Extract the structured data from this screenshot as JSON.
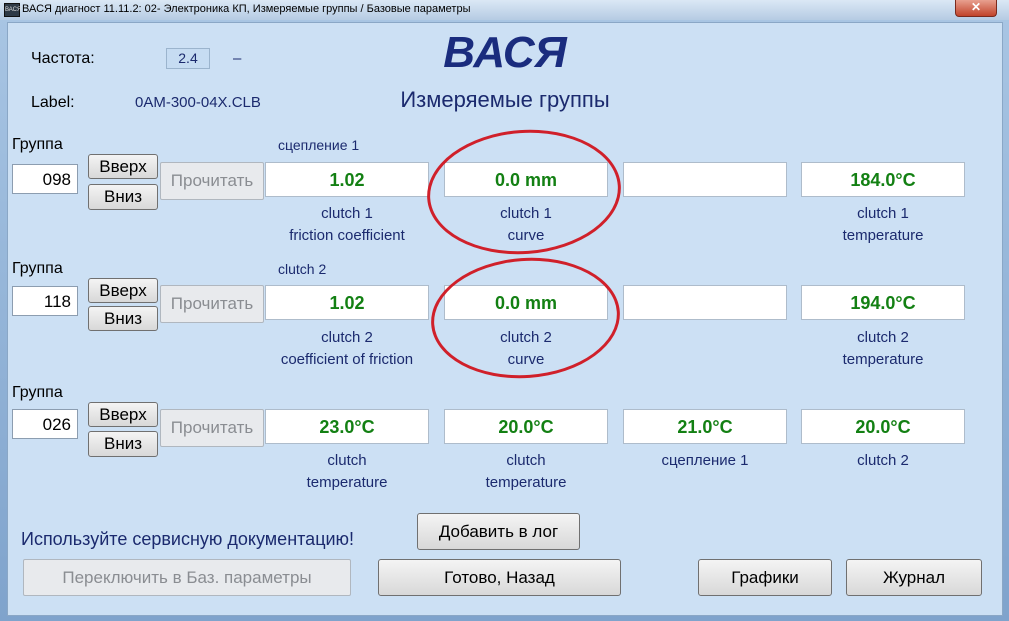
{
  "window": {
    "title": "ВАСЯ диагност 11.11.2: 02- Электроника КП,  Измеряемые группы / Базовые параметры",
    "icon_text": "ВАСЯ",
    "close_symbol": "✕"
  },
  "header": {
    "freq_label": "Частота:",
    "freq_value": "2.4",
    "freq_dash": "–",
    "label_label": "Label:",
    "label_value": "0AM-300-04X.CLB",
    "app_name": "ВАСЯ",
    "subtitle": "Измеряемые группы"
  },
  "groups": [
    {
      "label": "Группа",
      "number": "098",
      "up": "Вверх",
      "down": "Вниз",
      "read": "Прочитать",
      "title": "сцепление 1",
      "values": [
        "1.02",
        "0.0 mm",
        "",
        "184.0°C"
      ],
      "desc1": [
        "clutch 1",
        "clutch 1",
        "",
        "clutch 1"
      ],
      "desc2": [
        "friction coefficient",
        "curve",
        "",
        "temperature"
      ]
    },
    {
      "label": "Группа",
      "number": "118",
      "up": "Вверх",
      "down": "Вниз",
      "read": "Прочитать",
      "title": "clutch 2",
      "values": [
        "1.02",
        "0.0 mm",
        "",
        "194.0°C"
      ],
      "desc1": [
        "clutch 2",
        "clutch 2",
        "",
        "clutch 2"
      ],
      "desc2": [
        "coefficient of friction",
        "curve",
        "",
        "temperature"
      ]
    },
    {
      "label": "Группа",
      "number": "026",
      "up": "Вверх",
      "down": "Вниз",
      "read": "Прочитать",
      "title": "",
      "values": [
        "23.0°C",
        "20.0°C",
        "21.0°C",
        "20.0°C"
      ],
      "desc1": [
        "clutch",
        "clutch",
        "сцепление 1",
        "clutch 2"
      ],
      "desc2": [
        "temperature",
        "temperature",
        "",
        ""
      ]
    }
  ],
  "footer": {
    "notice": "Используйте сервисную документацию!",
    "add_log": "Добавить в лог",
    "switch_basic": "Переключить в Баз. параметры",
    "done_back": "Готово, Назад",
    "graphs": "Графики",
    "journal": "Журнал"
  },
  "colors": {
    "value_text": "#138013",
    "annotation_circle": "#d0202a",
    "heading": "#1a2c7e"
  }
}
